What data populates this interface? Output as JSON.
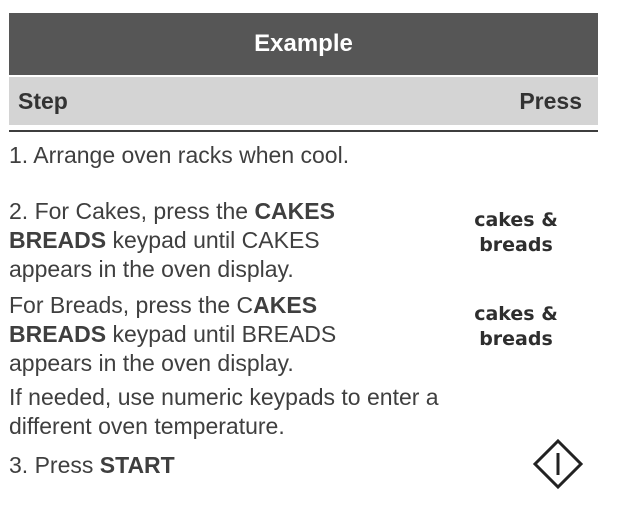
{
  "table": {
    "title": "Example",
    "header": {
      "step": "Step",
      "press": "Press"
    }
  },
  "steps": {
    "s1": "1.  Arrange oven racks when cool.",
    "s2": {
      "pre": "2.  For Cakes, press the ",
      "bold1": "CAKES",
      "bold2": "BREADS",
      "mid": " keypad until CAKES",
      "end": "appears in the oven display."
    },
    "s2b": {
      "pre": "For Breads, press the C",
      "bold1": "AKES",
      "bold2": "BREADS",
      "mid": " keypad until BREADS",
      "end": "appears in the oven display."
    },
    "note": {
      "line1": "If needed, use numeric keypads to enter a",
      "line2": "different oven temperature."
    },
    "s3": {
      "pre": "3.  Press ",
      "bold": "START"
    }
  },
  "keys": {
    "cakes_breads_1": {
      "line1": "cakes &",
      "line2": "breads"
    },
    "cakes_breads_2": {
      "line1": "cakes &",
      "line2": "breads"
    },
    "start_icon": "start-keypad-icon"
  },
  "colors": {
    "title_bg": "#565656",
    "header_bg": "#d4d4d4",
    "text": "#3f3f3f"
  }
}
